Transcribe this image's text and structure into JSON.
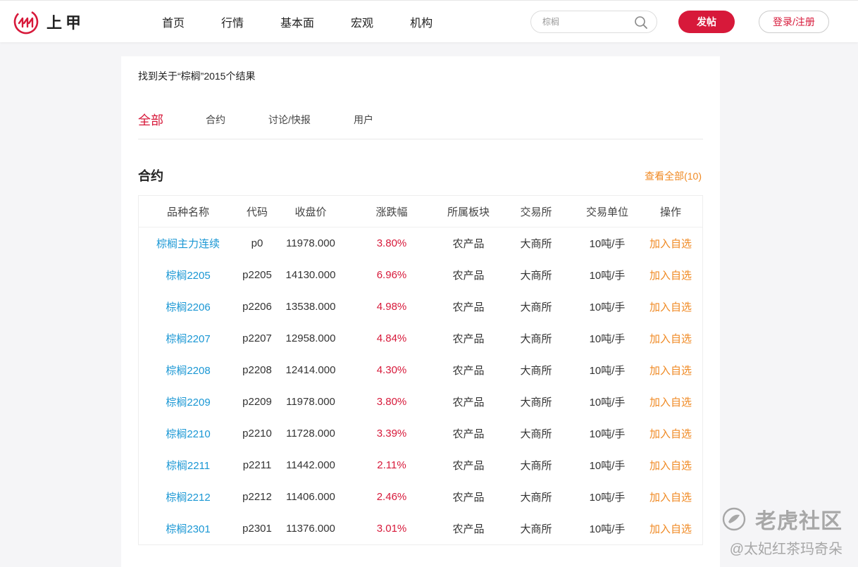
{
  "brand": {
    "name": "上甲",
    "brand_color": "#d7193a"
  },
  "nav": [
    {
      "label": "首页"
    },
    {
      "label": "行情"
    },
    {
      "label": "基本面"
    },
    {
      "label": "宏观"
    },
    {
      "label": "机构"
    }
  ],
  "search": {
    "placeholder": "棕榈",
    "icon": "search-icon"
  },
  "buttons": {
    "post": "发帖",
    "login": "登录/注册"
  },
  "result_summary": "找到关于“棕榈”2015个结果",
  "tabs": [
    {
      "label": "全部",
      "active": true
    },
    {
      "label": "合约",
      "active": false
    },
    {
      "label": "讨论/快报",
      "active": false
    },
    {
      "label": "用户",
      "active": false
    }
  ],
  "section": {
    "title": "合约",
    "view_all": "查看全部(10)"
  },
  "table": {
    "headers": [
      "品种名称",
      "代码",
      "收盘价",
      "涨跌幅",
      "所属板块",
      "交易所",
      "交易单位",
      "操作"
    ],
    "rows": [
      {
        "name": "棕榈主力连续",
        "code": "p0",
        "close": "11978.000",
        "change": "3.80%",
        "sector": "农产品",
        "exchange": "大商所",
        "unit": "10吨/手",
        "action": "加入自选"
      },
      {
        "name": "棕榈2205",
        "code": "p2205",
        "close": "14130.000",
        "change": "6.96%",
        "sector": "农产品",
        "exchange": "大商所",
        "unit": "10吨/手",
        "action": "加入自选"
      },
      {
        "name": "棕榈2206",
        "code": "p2206",
        "close": "13538.000",
        "change": "4.98%",
        "sector": "农产品",
        "exchange": "大商所",
        "unit": "10吨/手",
        "action": "加入自选"
      },
      {
        "name": "棕榈2207",
        "code": "p2207",
        "close": "12958.000",
        "change": "4.84%",
        "sector": "农产品",
        "exchange": "大商所",
        "unit": "10吨/手",
        "action": "加入自选"
      },
      {
        "name": "棕榈2208",
        "code": "p2208",
        "close": "12414.000",
        "change": "4.30%",
        "sector": "农产品",
        "exchange": "大商所",
        "unit": "10吨/手",
        "action": "加入自选"
      },
      {
        "name": "棕榈2209",
        "code": "p2209",
        "close": "11978.000",
        "change": "3.80%",
        "sector": "农产品",
        "exchange": "大商所",
        "unit": "10吨/手",
        "action": "加入自选"
      },
      {
        "name": "棕榈2210",
        "code": "p2210",
        "close": "11728.000",
        "change": "3.39%",
        "sector": "农产品",
        "exchange": "大商所",
        "unit": "10吨/手",
        "action": "加入自选"
      },
      {
        "name": "棕榈2211",
        "code": "p2211",
        "close": "11442.000",
        "change": "2.11%",
        "sector": "农产品",
        "exchange": "大商所",
        "unit": "10吨/手",
        "action": "加入自选"
      },
      {
        "name": "棕榈2212",
        "code": "p2212",
        "close": "11406.000",
        "change": "2.46%",
        "sector": "农产品",
        "exchange": "大商所",
        "unit": "10吨/手",
        "action": "加入自选"
      },
      {
        "name": "棕榈2301",
        "code": "p2301",
        "close": "11376.000",
        "change": "3.01%",
        "sector": "农产品",
        "exchange": "大商所",
        "unit": "10吨/手",
        "action": "加入自选"
      }
    ]
  },
  "watermark": {
    "line1": "老虎社区",
    "line2": "@太妃红茶玛奇朵",
    "icon": "tiger-community-icon"
  },
  "colors": {
    "accent": "#d7193a",
    "link": "#1a97d4",
    "action": "#f08a24"
  }
}
